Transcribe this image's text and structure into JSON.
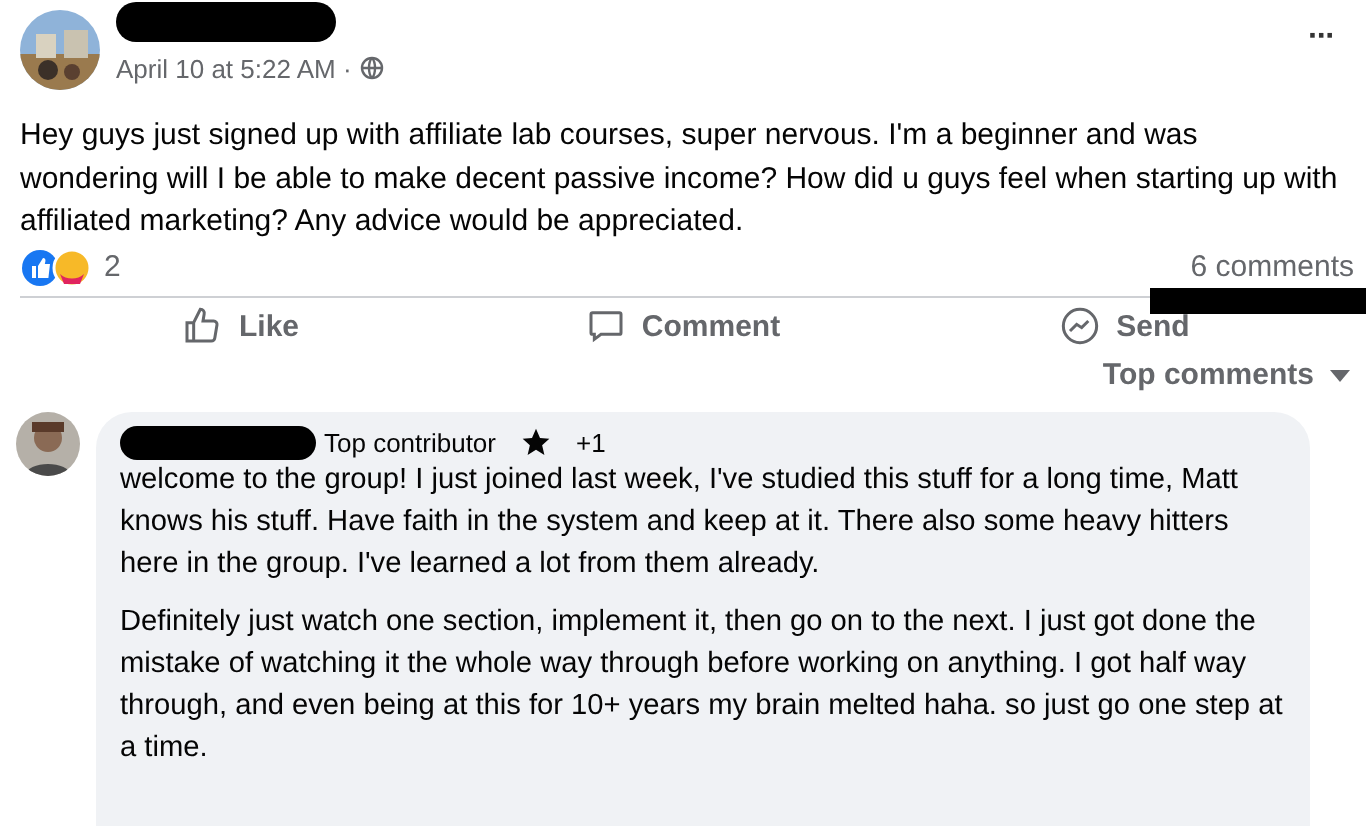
{
  "post": {
    "date": "April 10 at 5:22 AM ·",
    "more": "···",
    "body": "Hey guys just signed up with affiliate lab courses, super nervous. I'm a beginner and was wondering will I be able to make decent passive income? How did u guys feel when starting up with affiliated marketing? Any advice would be appreciated.",
    "reaction_count": "2",
    "comments_count": "6 comments"
  },
  "actions": [
    {
      "kind": "like",
      "label": "Like"
    },
    {
      "kind": "comment",
      "label": "Comment"
    },
    {
      "kind": "send",
      "label": "Send"
    }
  ],
  "sort": {
    "label": "Top comments"
  },
  "comment": {
    "badge": "Top contributor",
    "badge_extra": "+1",
    "paragraphs": [
      "welcome to the group! I just joined last week, I've studied this stuff for a long time, Matt knows his stuff. Have faith in the system and keep at it. There also some heavy hitters here in the group. I've learned a lot from them already.",
      "Definitely just watch one section, implement it, then go on to the next. I just got done the mistake of watching it the whole way through before working on anything. I got half way through, and even being at this for 10+ years my brain melted haha. so just go one step at a time."
    ]
  }
}
